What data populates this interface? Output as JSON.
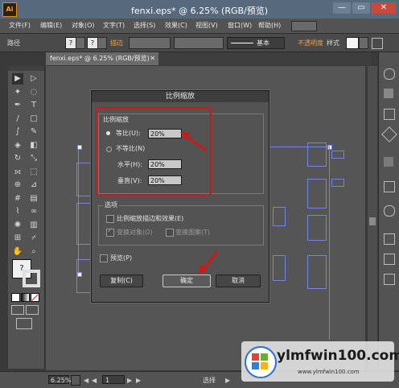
{
  "window": {
    "app_logo": "Ai",
    "title": "fenxi.eps* @ 6.25% (RGB/预览)",
    "buttons": {
      "minimize": "—",
      "maximize": "▭",
      "close": "✕"
    }
  },
  "menu": [
    "文件(F)",
    "编辑(E)",
    "对象(O)",
    "文字(T)",
    "选择(S)",
    "效果(C)",
    "视图(V)",
    "窗口(W)",
    "帮助(H)"
  ],
  "control_bar": {
    "path_label": "路径",
    "fill_value": "?",
    "stroke_value": "?",
    "stroke_label": "描边",
    "stroke_style_label": "基本",
    "opacity_label": "不透明度",
    "style_label": "样式"
  },
  "document_tab": {
    "label": "fenxi.eps* @ 6.25% (RGB/预览)",
    "close": "✕"
  },
  "tools_panel": {
    "icons": [
      "select-icon",
      "direct-select-icon",
      "magic-wand-icon",
      "lasso-icon",
      "pen-icon",
      "type-icon",
      "line-icon",
      "rectangle-icon",
      "brush-icon",
      "pencil-icon",
      "blob-brush-icon",
      "eraser-icon",
      "rotate-icon",
      "scale-icon",
      "width-icon",
      "free-transform-icon",
      "shape-builder-icon",
      "perspective-icon",
      "mesh-icon",
      "gradient-icon",
      "eyedropper-icon",
      "blend-icon",
      "symbol-sprayer-icon",
      "column-graph-icon",
      "artboard-icon",
      "slice-icon",
      "hand-icon",
      "zoom-icon"
    ],
    "fill_stroke_q": "?"
  },
  "dialog": {
    "title": "比例缩放",
    "uniform_group": "比例缩放",
    "uniform_label": "等比(U):",
    "uniform_value": "20%",
    "non_uniform_label": "不等比(N)",
    "horizontal_label": "水平(H):",
    "horizontal_value": "20%",
    "vertical_label": "垂直(V):",
    "vertical_value": "20%",
    "options_group": "选项",
    "scale_strokes_label": "比例缩放描边和效果(E)",
    "transform_objects_label": "变换对象(O)",
    "transform_patterns_label": "变换图案(T)",
    "preview_label": "预览(P)",
    "copy_button": "复制(C)",
    "ok_button": "确定",
    "cancel_button": "取消"
  },
  "status_bar": {
    "zoom": "6.25%",
    "artboard": "1",
    "mode": "选择"
  },
  "watermark": {
    "brand": "ylmfwin100.com",
    "sub": "www.ylmfwin100.com"
  },
  "colors": {
    "annotation_red": "#d01818",
    "selection_blue": "#6f86e4",
    "ui_gray": "#535353"
  }
}
